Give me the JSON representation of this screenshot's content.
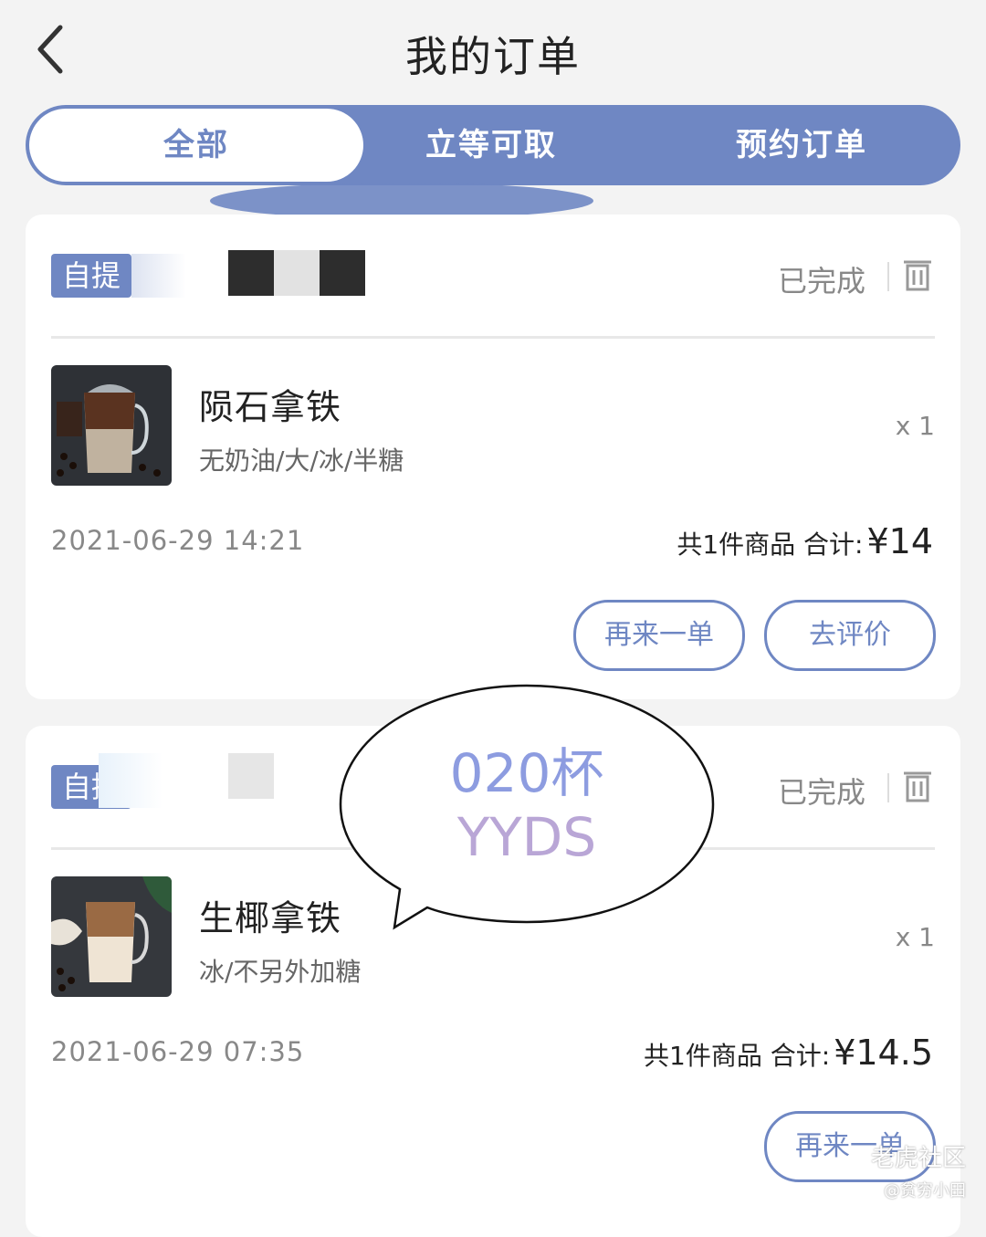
{
  "header": {
    "title": "我的订单"
  },
  "tabs": [
    {
      "label": "全部"
    },
    {
      "label": "立等可取"
    },
    {
      "label": "预约订单"
    }
  ],
  "orders": [
    {
      "badge": "自提",
      "status": "已完成",
      "product_name": "陨石拿铁",
      "spec": "无奶油/大/冰/半糖",
      "qty": "x 1",
      "time": "2021-06-29 14:21",
      "summary": "共1件商品 合计:",
      "price": "¥14",
      "buttons": {
        "reorder": "再来一单",
        "review": "去评价"
      }
    },
    {
      "badge": "自提",
      "status": "已完成",
      "product_name": "生椰拿铁",
      "spec": "冰/不另外加糖",
      "qty": "x 1",
      "time": "2021-06-29 07:35",
      "summary": "共1件商品 合计:",
      "price": "¥14.5",
      "buttons": {
        "reorder": "再来一单"
      }
    }
  ],
  "overlay": {
    "line1": "020杯",
    "line2": "YYDS"
  },
  "watermark": {
    "line1": "老虎社区",
    "line2": "@贫穷小田"
  },
  "colors": {
    "accent": "#6f87c3",
    "background": "#f3f3f3"
  }
}
